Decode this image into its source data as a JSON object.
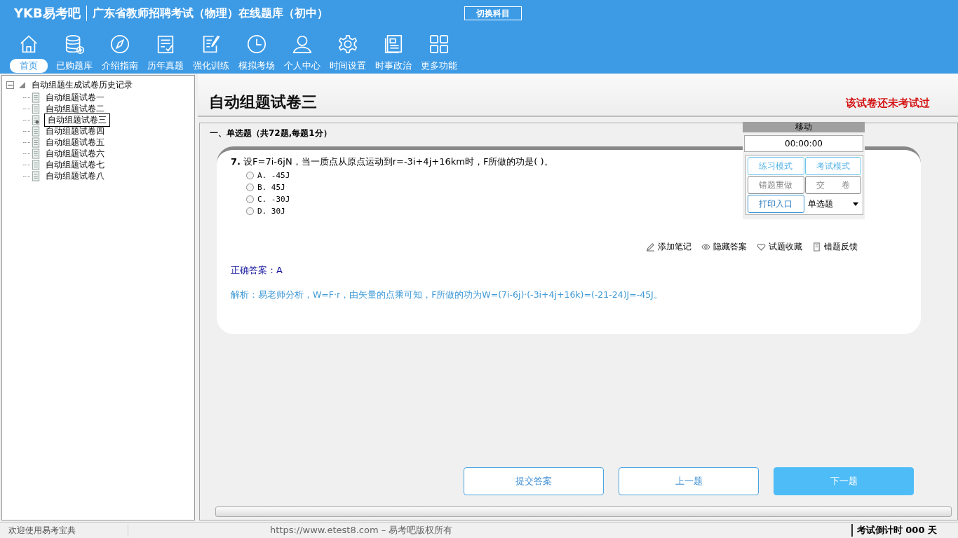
{
  "header": {
    "logo": "YKB易考吧",
    "title": "广东省教师招聘考试（物理）在线题库（初中）",
    "switch_button": "切换科目"
  },
  "nav": [
    {
      "label": "首页",
      "selected": true
    },
    {
      "label": "已购题库",
      "selected": false
    },
    {
      "label": "介绍指南",
      "selected": false
    },
    {
      "label": "历年真题",
      "selected": false
    },
    {
      "label": "强化训练",
      "selected": false
    },
    {
      "label": "模拟考场",
      "selected": false
    },
    {
      "label": "个人中心",
      "selected": false
    },
    {
      "label": "时间设置",
      "selected": false
    },
    {
      "label": "时事政治",
      "selected": false
    },
    {
      "label": "更多功能",
      "selected": false
    }
  ],
  "tree": {
    "label": "自动组题生成试卷历史记录",
    "expanded": true,
    "children": [
      {
        "label": "自动组题试卷一",
        "selected": false
      },
      {
        "label": "自动组题试卷二",
        "selected": false
      },
      {
        "label": "自动组题试卷三",
        "selected": true
      },
      {
        "label": "自动组题试卷四",
        "selected": false
      },
      {
        "label": "自动组题试卷五",
        "selected": false
      },
      {
        "label": "自动组题试卷六",
        "selected": false
      },
      {
        "label": "自动组题试卷七",
        "selected": false
      },
      {
        "label": "自动组题试卷八",
        "selected": false
      }
    ]
  },
  "paper": {
    "title": "自动组题试卷三",
    "status": "该试卷还未考试过",
    "section": "一、单选题（共72题,每题1分）"
  },
  "question": {
    "number": "7.",
    "text": "设F=7i-6jN，当一质点从原点运动到r=-3i+4j+16km时，F所做的功是( )。",
    "options": [
      {
        "label": "A. -45J",
        "selected": false
      },
      {
        "label": "B. 45J",
        "selected": false
      },
      {
        "label": "C. -30J",
        "selected": false
      },
      {
        "label": "D. 30J",
        "selected": false
      }
    ],
    "tools": [
      "添加笔记",
      "隐藏答案",
      "试题收藏",
      "错题反馈"
    ],
    "answer_label": "正确答案：",
    "answer": "A",
    "analysis": "解析：易老师分析，W=F·r，由矢量的点乘可知，F所做的功为W=(7i-6j)·(-3i+4j+16k)=(-21-24)J=-45J。"
  },
  "panel": {
    "title": "移动",
    "timer": "00:00:00",
    "buttons": [
      {
        "label": "练习模式",
        "kind": "blue"
      },
      {
        "label": "考试模式",
        "kind": "blue"
      },
      {
        "label": "错题重做",
        "kind": "gray"
      },
      {
        "label": "交　　卷",
        "kind": "gray"
      },
      {
        "label": "打印入口",
        "kind": "dark"
      }
    ],
    "type_select": "单选题"
  },
  "actions": [
    {
      "label": "提交答案",
      "kind": "outline"
    },
    {
      "label": "上一题",
      "kind": "outline"
    },
    {
      "label": "下一题",
      "kind": "filled"
    }
  ],
  "status_bar": {
    "welcome": "欢迎使用易考宝典",
    "copyright": "https://www.etest8.com – 易考吧版权所有",
    "countdown": "考试倒计时 000 天"
  }
}
